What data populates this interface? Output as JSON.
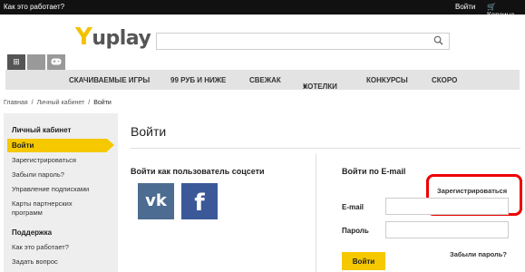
{
  "topbar": {
    "how_it_works": "Как это работает?",
    "login": "Войти",
    "cart": "Корзина"
  },
  "logo": {
    "y": "Y",
    "play": "uplay"
  },
  "search": {
    "placeholder": "",
    "value": ""
  },
  "platforms": [
    {
      "icon": "windows-icon",
      "glyph": "⊞"
    },
    {
      "icon": "apple-icon",
      "glyph": ""
    },
    {
      "icon": "gamepad-icon",
      "glyph": "◫"
    }
  ],
  "nav": {
    "items": [
      "СКАЧИВАЕМЫЕ ИГРЫ",
      "99 РУБ И НИЖЕ",
      "СВЕЖАК",
      "ХОТЕЛКИ",
      "КОНКУРСЫ",
      "СКОРО"
    ]
  },
  "breadcrumbs": {
    "home": "Главная",
    "cabinet": "Личный кабинет",
    "current": "Войти",
    "sep": "/"
  },
  "sidebar": {
    "section1_title": "Личный кабинет",
    "active_item": "Войти",
    "items1": [
      "Зарегистрироваться",
      "Забыли пароль?",
      "Управление подписками",
      "Карты партнерских",
      "программ"
    ],
    "section2_title": "Поддержка",
    "items2": [
      "Как это работает?",
      "Задать вопрос"
    ]
  },
  "main": {
    "title": "Войти",
    "social_heading": "Войти как пользователь соцсети",
    "vk_label": "vk",
    "fb_label": "f",
    "email_heading": "Войти по E-mail",
    "register_link": "Зарегистрироваться",
    "email_label": "E-mail",
    "email_value": "",
    "password_label": "Пароль",
    "password_value": "",
    "forgot_link": "Забыли пароль?",
    "login_button": "Войти"
  },
  "colors": {
    "accent": "#f5c800",
    "topbar": "#111111",
    "vk": "#4c6c91",
    "facebook": "#3b5998",
    "annotation": "#ee0000"
  }
}
